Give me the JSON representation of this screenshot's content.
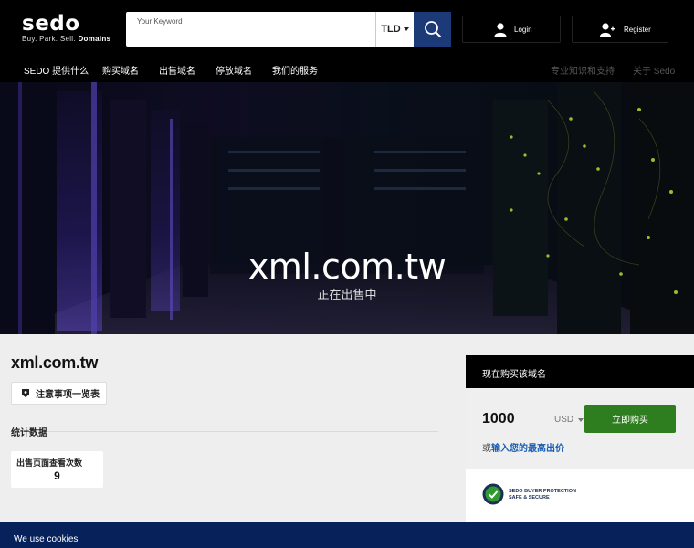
{
  "header": {
    "brand": "sedo",
    "tagline_prefix": "Buy. Park. Sell.",
    "tagline_bold": "Domains",
    "search": {
      "label": "Your Keyword",
      "value": "",
      "placeholder": ""
    },
    "tld_label": "TLD",
    "login_label": "Login",
    "register_label": "Register"
  },
  "nav": {
    "items": [
      "SEDO 提供什么",
      "购买域名",
      "出售域名",
      "停放域名",
      "我们的服务"
    ],
    "right_items": [
      "专业知识和支持",
      "关于 Sedo"
    ]
  },
  "hero": {
    "domain": "xml.com.tw",
    "status": "正在出售中"
  },
  "main": {
    "domain": "xml.com.tw",
    "notes_label": "注意事项一览表",
    "stats_heading": "统计数据",
    "stat": {
      "label": "出售页面查看次数",
      "value": "9"
    }
  },
  "buy_panel": {
    "heading": "现在购买该域名",
    "price": "1000",
    "currency": "USD",
    "buy_label": "立即购买",
    "offer_prefix": "或",
    "offer_link": "输入您的最高出价",
    "protection_line1": "SEDO BUYER PROTECTION",
    "protection_line2": "SAFE & SECURE"
  },
  "cookie": {
    "text": "We use cookies"
  },
  "colors": {
    "accent_blue": "#1c3a78",
    "buy_green": "#2e7d1e",
    "cookie_bg": "#07225b"
  }
}
